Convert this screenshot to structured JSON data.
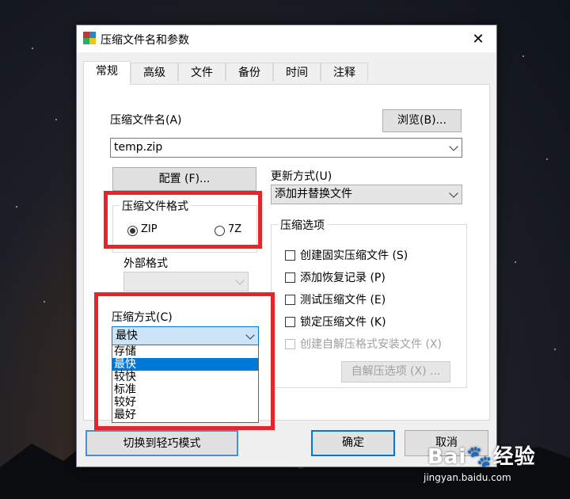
{
  "window": {
    "title": "压缩文件名和参数",
    "close_glyph": "✕"
  },
  "tabs": [
    {
      "label": "常规",
      "active": true
    },
    {
      "label": "高级"
    },
    {
      "label": "文件"
    },
    {
      "label": "备份"
    },
    {
      "label": "时间"
    },
    {
      "label": "注释"
    }
  ],
  "archive_name": {
    "label": "压缩文件名(A)",
    "value": "temp.zip",
    "browse_label": "浏览(B)..."
  },
  "profiles_label": "配置 (F)...",
  "update_mode": {
    "label": "更新方式(U)",
    "value": "添加并替换文件"
  },
  "format": {
    "group_title": "压缩文件格式",
    "zip_label": "ZIP",
    "sevenz_label": "7Z",
    "selected": "ZIP"
  },
  "external_format_label": "外部格式",
  "compression_method": {
    "label": "压缩方式(C)",
    "value": "最快",
    "options": [
      "存储",
      "最快",
      "较快",
      "标准",
      "较好",
      "最好"
    ],
    "highlighted": "最快"
  },
  "options": {
    "group_title": "压缩选项",
    "items": [
      {
        "label": "创建固实压缩文件 (S)",
        "enabled": true
      },
      {
        "label": "添加恢复记录 (P)",
        "enabled": true
      },
      {
        "label": "测试压缩文件 (E)",
        "enabled": true
      },
      {
        "label": "锁定压缩文件 (K)",
        "enabled": true
      },
      {
        "label": "创建自解压格式安装文件 (X)",
        "enabled": false
      }
    ],
    "sfx_button_label": "自解压选项 (X) ..."
  },
  "footer": {
    "switch_label": "切换到轻巧模式",
    "ok_label": "确定",
    "cancel_label": "取消"
  },
  "watermark": {
    "brand": "Bai🐾经验",
    "url": "jingyan.baidu.com"
  },
  "colors": {
    "highlight_red": "#e8232a",
    "selection_blue": "#0078d7"
  }
}
